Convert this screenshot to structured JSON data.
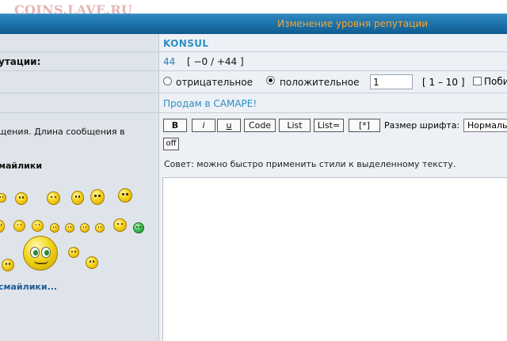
{
  "watermark": "COINS.LAVE.RU",
  "header": {
    "title": "Изменение уровня репутации"
  },
  "rows": {
    "author_value": "KONSUL",
    "reputation_label": "утации:",
    "reputation_value": "44",
    "reputation_range": "[ −0 / +44 ]",
    "type_option_negative": "отрицательное",
    "type_option_positive": "положительное",
    "type_selected": "положительное",
    "amount_value": "1",
    "amount_range": "[ 1 – 10 ]",
    "checkbox_label": "Поби",
    "subject_link": "Продам в САМАРЕ!"
  },
  "message": {
    "hint_line1": "щения. Длина сообщения в",
    "hint_line2": "",
    "smilies_title": "майлики",
    "more_smilies": "смайлики...",
    "toolbar": {
      "bold": "B",
      "italic": "i",
      "underline": "u",
      "code": "Code",
      "list": "List",
      "list_ordered": "List=",
      "list_item": "[*]",
      "font_size_label": "Размер шрифта:",
      "font_size_value": "Нормаль",
      "off": "off"
    },
    "tip": "Совет: можно быстро применить стили к выделенному тексту.",
    "textarea_value": ""
  },
  "colors": {
    "header_blue": "#1a6ea6",
    "header_title": "#f7a531",
    "link_blue": "#2b8fc3",
    "left_panel": "#dfe4ea",
    "right_panel": "#edf1f5"
  }
}
